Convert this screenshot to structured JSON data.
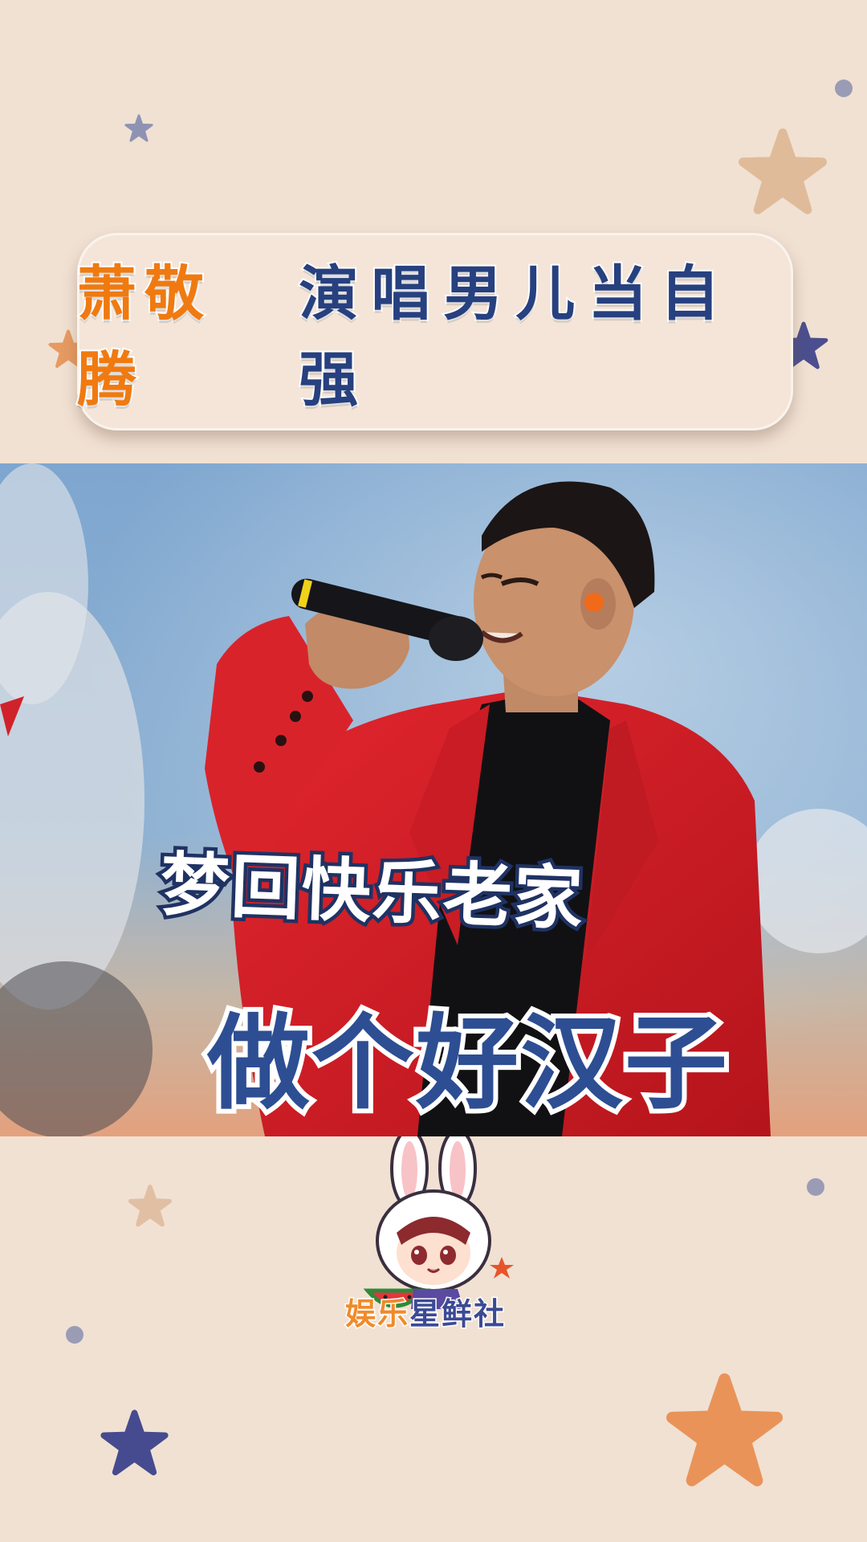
{
  "title": {
    "name": "萧敬腾",
    "song": "演唱男儿当自强"
  },
  "subtitles": {
    "line1": "梦回快乐老家",
    "line2": "做个好汉子"
  },
  "brand": {
    "part1": "娱乐",
    "part2": "星鲜社"
  },
  "colors": {
    "background": "#f1e1d3",
    "title_name": "#f07a10",
    "title_song": "#27407f",
    "jacket": "#d8232a",
    "subtitle_accent": "#2d4e93"
  },
  "icons": [
    "star-decoration",
    "bunny-mascot-logo",
    "watermelon-icon"
  ]
}
